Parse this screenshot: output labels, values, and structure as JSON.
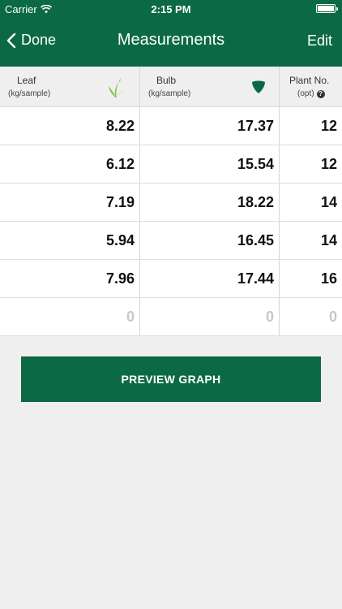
{
  "status_bar": {
    "carrier": "Carrier",
    "time": "2:15 PM"
  },
  "nav": {
    "back_label": "Done",
    "title": "Measurements",
    "edit_label": "Edit"
  },
  "columns": [
    {
      "name": "Leaf",
      "unit": "(kg/sample)",
      "icon": "leaf-icon"
    },
    {
      "name": "Bulb",
      "unit": "(kg/sample)",
      "icon": "bulb-icon"
    },
    {
      "name": "Plant No.",
      "unit": "(opt)",
      "icon": "help-icon"
    }
  ],
  "rows": [
    [
      "8.22",
      "17.37",
      "12"
    ],
    [
      "6.12",
      "15.54",
      "12"
    ],
    [
      "7.19",
      "18.22",
      "14"
    ],
    [
      "5.94",
      "16.45",
      "14"
    ],
    [
      "7.96",
      "17.44",
      "16"
    ],
    [
      "0",
      "0",
      "0"
    ]
  ],
  "preview_button": "PREVIEW GRAPH",
  "colors": {
    "brand_green": "#0b6a45",
    "leaf_green": "#7cc242",
    "placeholder_gray": "#c8c8c8"
  }
}
